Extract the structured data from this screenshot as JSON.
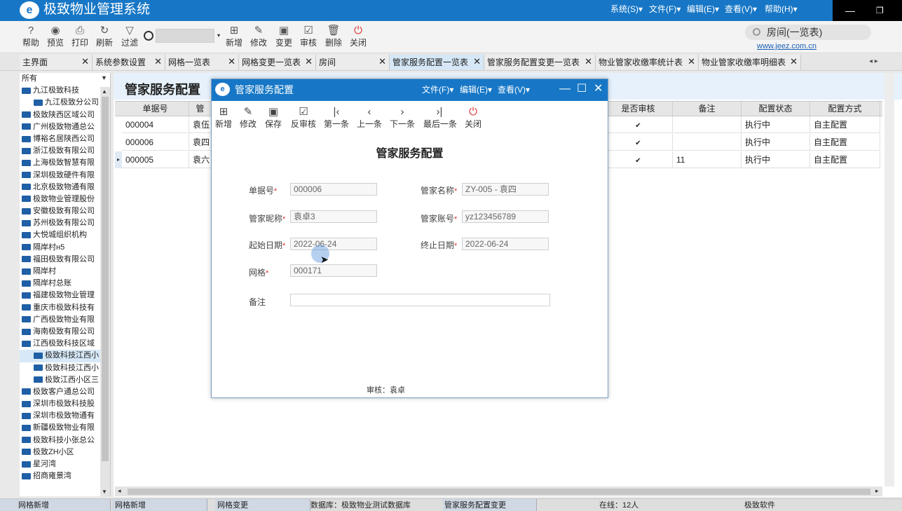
{
  "app": {
    "title": "极致物业管理系统",
    "logo_glyph": "e",
    "menu": [
      "系统(S)▾",
      "文件(F)▾",
      "编辑(E)▾",
      "查看(V)▾",
      "帮助(H)▾"
    ],
    "window_min": "—",
    "window_restore": "❐"
  },
  "toolbar": {
    "buttons": [
      {
        "label": "帮助",
        "icon": "help-icon",
        "glyph": "?"
      },
      {
        "label": "预览",
        "icon": "eye-icon",
        "glyph": "◉"
      },
      {
        "label": "打印",
        "icon": "print-icon",
        "glyph": "⎙"
      },
      {
        "label": "刷新",
        "icon": "refresh-icon",
        "glyph": "↻"
      },
      {
        "label": "过滤",
        "icon": "filter-icon",
        "glyph": "▽"
      },
      {
        "label": "新增",
        "icon": "add-icon",
        "glyph": "⊞"
      },
      {
        "label": "修改",
        "icon": "edit-icon",
        "glyph": "✎"
      },
      {
        "label": "变更",
        "icon": "save-icon",
        "glyph": "▣"
      },
      {
        "label": "审核",
        "icon": "audit-icon",
        "glyph": "☑"
      },
      {
        "label": "删除",
        "icon": "delete-icon",
        "glyph": "🗑"
      },
      {
        "label": "关闭",
        "icon": "power-icon",
        "glyph": "⏻"
      }
    ],
    "search_dropdown": "▾",
    "room_search": "房间(一览表)",
    "website": "www.jeez.com.cn"
  },
  "tabs": [
    {
      "label": "主界面",
      "close": "✕"
    },
    {
      "label": "系统参数设置",
      "close": "✕"
    },
    {
      "label": "网格一览表",
      "close": "✕"
    },
    {
      "label": "网格变更一览表",
      "close": "✕"
    },
    {
      "label": "房间",
      "close": "✕"
    },
    {
      "label": "管家服务配置一览表",
      "close": "✕"
    },
    {
      "label": "管家服务配置变更一览表",
      "close": "✕"
    },
    {
      "label": "物业管家收缴率统计表",
      "close": "✕"
    },
    {
      "label": "物业管家收缴率明细表",
      "close": "✕"
    }
  ],
  "tab_scroll": "◂ ▸",
  "tree": {
    "pin": "▼",
    "scroll_up": "▲",
    "scroll_down": "▼",
    "items": [
      {
        "label": "所有",
        "indent": 0,
        "folder": false
      },
      {
        "label": "九江极致科技",
        "indent": 0,
        "folder": true
      },
      {
        "label": "九江极致分公司",
        "indent": 1,
        "folder": true
      },
      {
        "label": "极致陕西区域公司",
        "indent": 0,
        "folder": true
      },
      {
        "label": "广州极致物通总公",
        "indent": 0,
        "folder": true
      },
      {
        "label": "博裕名居陕西公司",
        "indent": 0,
        "folder": true
      },
      {
        "label": "浙江极致有限公司",
        "indent": 0,
        "folder": true
      },
      {
        "label": "上海极致智慧有限",
        "indent": 0,
        "folder": true
      },
      {
        "label": "深圳极致硬件有限",
        "indent": 0,
        "folder": true
      },
      {
        "label": "北京极致物通有限",
        "indent": 0,
        "folder": true
      },
      {
        "label": "极致物业管理股份",
        "indent": 0,
        "folder": true
      },
      {
        "label": "安徽极致有限公司",
        "indent": 0,
        "folder": true
      },
      {
        "label": "苏州极致有限公司",
        "indent": 0,
        "folder": true
      },
      {
        "label": "大悦城组织机构",
        "indent": 0,
        "folder": true
      },
      {
        "label": "隔岸村н5",
        "indent": 0,
        "folder": true
      },
      {
        "label": "福田极致有限公司",
        "indent": 0,
        "folder": true
      },
      {
        "label": "隔岸村",
        "indent": 0,
        "folder": true
      },
      {
        "label": "隔岸村总账",
        "indent": 0,
        "folder": true
      },
      {
        "label": "福建极致物业管理",
        "indent": 0,
        "folder": true
      },
      {
        "label": "重庆市极致科技有",
        "indent": 0,
        "folder": true
      },
      {
        "label": "广西极致物业有限",
        "indent": 0,
        "folder": true
      },
      {
        "label": "海南极致有限公司",
        "indent": 0,
        "folder": true
      },
      {
        "label": "江西极致科技区域",
        "indent": 0,
        "folder": true
      },
      {
        "label": "极致科技江西小",
        "indent": 1,
        "folder": true,
        "selected": true
      },
      {
        "label": "极致科技江西小",
        "indent": 1,
        "folder": true
      },
      {
        "label": "极致江西小区三",
        "indent": 1,
        "folder": true
      },
      {
        "label": "极致客户通总公司",
        "indent": 0,
        "folder": true
      },
      {
        "label": "深圳市极致科技股",
        "indent": 0,
        "folder": true
      },
      {
        "label": "深圳市极致物通有",
        "indent": 0,
        "folder": true
      },
      {
        "label": "新疆极致物业有限",
        "indent": 0,
        "folder": true
      },
      {
        "label": "极致科技小张总公",
        "indent": 0,
        "folder": true
      },
      {
        "label": "极致ZH小区",
        "indent": 0,
        "folder": true
      },
      {
        "label": "星河湾",
        "indent": 0,
        "folder": true
      },
      {
        "label": "招商雍景湾",
        "indent": 0,
        "folder": true
      }
    ]
  },
  "main": {
    "title": "管家服务配置",
    "columns": [
      "单据号",
      "管",
      "是否审核",
      "备注",
      "配置状态",
      "配置方式"
    ],
    "rows": [
      {
        "no": "000004",
        "name": "袁伍",
        "audited": "✔",
        "note": "",
        "status": "执行中",
        "mode": "自主配置"
      },
      {
        "no": "000006",
        "name": "袁四",
        "audited": "✔",
        "note": "",
        "status": "执行中",
        "mode": "自主配置"
      },
      {
        "no": "000005",
        "name": "袁六",
        "audited": "✔",
        "note": "11",
        "status": "执行中",
        "mode": "自主配置"
      }
    ],
    "row_indicator": "▸",
    "hscroll_left": "◂",
    "hscroll_right": "▸"
  },
  "status_bar": {
    "items": [
      "网格新增",
      "网格新增",
      "网格变更",
      "数据库：极致物业测试数据库",
      "管家服务配置变更",
      "在线：12人",
      "极致软件"
    ]
  },
  "dialog": {
    "title": "管家服务配置",
    "logo_glyph": "e",
    "menu": [
      "文件(F)▾",
      "编辑(E)▾",
      "查看(V)▾"
    ],
    "win_min": "—",
    "win_max": "☐",
    "win_close": "✕",
    "toolbar": [
      {
        "label": "新增",
        "icon": "add-icon",
        "glyph": "⊞"
      },
      {
        "label": "修改",
        "icon": "edit-icon",
        "glyph": "✎"
      },
      {
        "label": "保存",
        "icon": "save-icon",
        "glyph": "▣"
      },
      {
        "label": "反审核",
        "icon": "unaudit-icon",
        "glyph": "☑"
      },
      {
        "label": "第一条",
        "icon": "first-icon",
        "glyph": "|‹"
      },
      {
        "label": "上一条",
        "icon": "prev-icon",
        "glyph": "‹"
      },
      {
        "label": "下一条",
        "icon": "next-icon",
        "glyph": "›"
      },
      {
        "label": "最后一条",
        "icon": "last-icon",
        "glyph": "›|"
      },
      {
        "label": "关闭",
        "icon": "power-icon",
        "glyph": "⏻"
      }
    ],
    "heading": "管家服务配置",
    "required_mark": "*",
    "fields": {
      "doc_no": {
        "label": "单据号",
        "value": "000006"
      },
      "steward_name": {
        "label": "管家名称",
        "value": "ZY-005 - 袁四"
      },
      "steward_nickname": {
        "label": "管家昵称",
        "value": "袁卓3"
      },
      "steward_account": {
        "label": "管家账号",
        "value": "yz123456789"
      },
      "start_date": {
        "label": "起始日期",
        "value": "2022-06-24"
      },
      "end_date": {
        "label": "终止日期",
        "value": "2022-06-24"
      },
      "grid": {
        "label": "网格",
        "value": "000171"
      },
      "remark": {
        "label": "备注",
        "value": ""
      }
    },
    "footer": "审核：袁卓",
    "cursor": "➤"
  }
}
